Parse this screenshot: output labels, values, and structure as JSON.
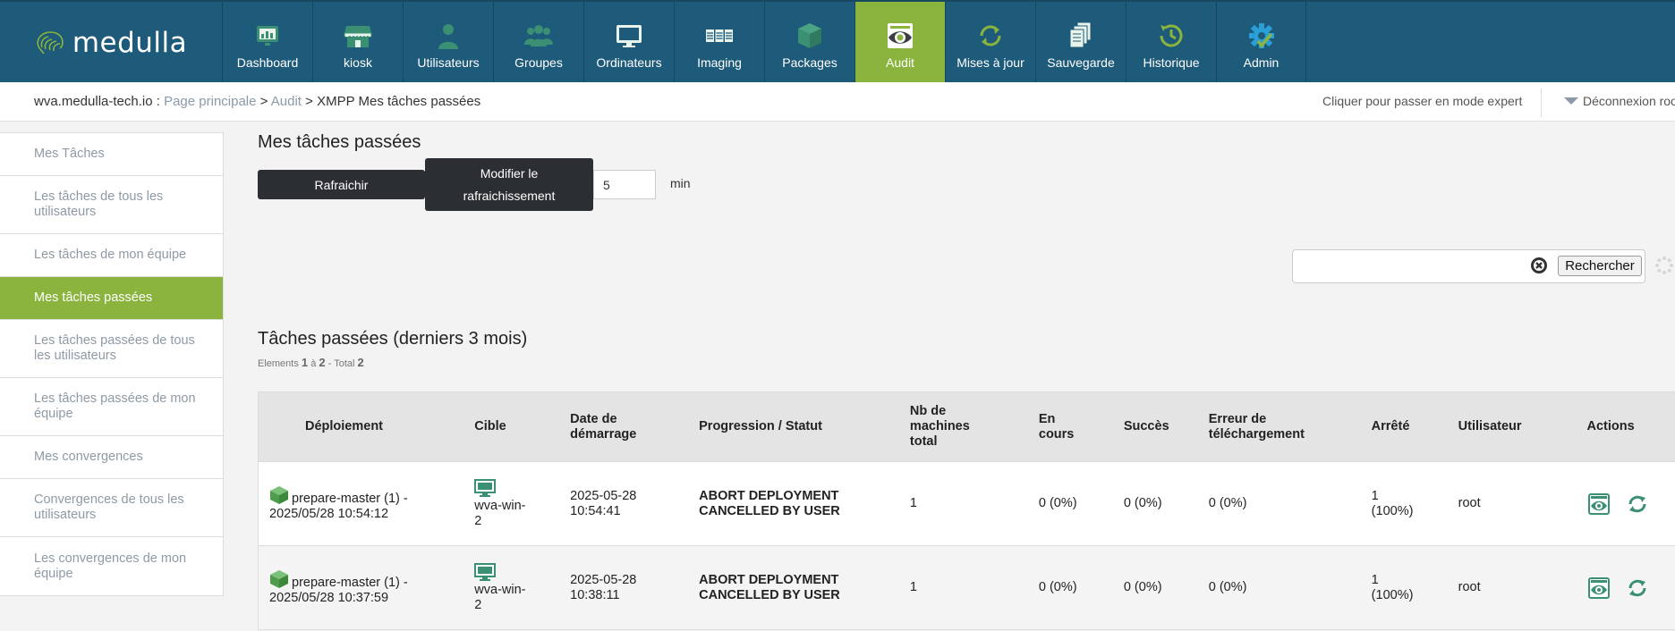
{
  "brand": {
    "name": "medulla"
  },
  "colors": {
    "nav_bg": "#1e5a79",
    "accent": "#8ab43e",
    "status_text": "#2a8a2a",
    "icon_teal": "#3b8f72"
  },
  "nav": {
    "items": [
      {
        "label": "Dashboard",
        "icon": "dashboard-icon"
      },
      {
        "label": "kiosk",
        "icon": "kiosk-store-icon"
      },
      {
        "label": "Utilisateurs",
        "icon": "user-icon"
      },
      {
        "label": "Groupes",
        "icon": "groups-icon"
      },
      {
        "label": "Ordinateurs",
        "icon": "monitor-icon"
      },
      {
        "label": "Imaging",
        "icon": "imaging-icon"
      },
      {
        "label": "Packages",
        "icon": "package-box-icon"
      },
      {
        "label": "Audit",
        "icon": "audit-eye-icon",
        "active": true
      },
      {
        "label": "Mises à jour",
        "icon": "update-arrows-icon"
      },
      {
        "label": "Sauvegarde",
        "icon": "backup-files-icon"
      },
      {
        "label": "Historique",
        "icon": "history-clock-icon"
      },
      {
        "label": "Admin",
        "icon": "admin-gear-icon"
      }
    ]
  },
  "breadcrumb": {
    "host": "wva.medulla-tech.io",
    "sep1": " : ",
    "home": "Page principale",
    "sep2": " > ",
    "section": "Audit",
    "sep3": " > ",
    "current": "XMPP Mes tâches passées"
  },
  "header_right": {
    "expert_mode": "Cliquer pour passer en mode expert",
    "logout": "Déconnexion roo"
  },
  "sidebar": {
    "items": [
      {
        "label": "Mes Tâches"
      },
      {
        "label": "Les tâches de tous les utilisateurs"
      },
      {
        "label": "Les tâches de mon équipe"
      },
      {
        "label": "Mes tâches passées",
        "active": true
      },
      {
        "label": "Les tâches passées de tous les utilisateurs"
      },
      {
        "label": "Les tâches passées de mon équipe"
      },
      {
        "label": "Mes convergences"
      },
      {
        "label": "Convergences de tous les utilisateurs"
      },
      {
        "label": "Les convergences de mon équipe"
      }
    ]
  },
  "main": {
    "title": "Mes tâches passées",
    "refresh_label": "Rafraichir",
    "modify_label": "Modifier le rafraichissement",
    "interval_value": "5",
    "interval_unit": "min",
    "search_placeholder": "",
    "search_button": "Rechercher",
    "list_title": "Tâches passées (derniers 3 mois)",
    "count": {
      "prefix": "Elements",
      "from": "1",
      "to_word": "à",
      "to": "2",
      "total_word": "- Total",
      "total": "2"
    }
  },
  "table": {
    "columns": [
      "Déploiement",
      "Cible",
      "Date de démarrage",
      "Progression / Statut",
      "Nb de machines total",
      "En cours",
      "Succès",
      "Erreur de téléchargement",
      "Arrêté",
      "Utilisateur",
      "Actions"
    ],
    "rows": [
      {
        "deployment": "prepare-master (1) - 2025/05/28 10:54:12",
        "target": "wva-win-2",
        "start": "2025-05-28 10:54:41",
        "status": "ABORT DEPLOYMENT CANCELLED BY USER",
        "total": "1",
        "in_progress": "0 (0%)",
        "success": "0 (0%)",
        "download_error": "0 (0%)",
        "stopped": "1 (100%)",
        "user": "root"
      },
      {
        "deployment": "prepare-master (1) - 2025/05/28 10:37:59",
        "target": "wva-win-2",
        "start": "2025-05-28 10:38:11",
        "status": "ABORT DEPLOYMENT CANCELLED BY USER",
        "total": "1",
        "in_progress": "0 (0%)",
        "success": "0 (0%)",
        "download_error": "0 (0%)",
        "stopped": "1 (100%)",
        "user": "root"
      }
    ]
  }
}
